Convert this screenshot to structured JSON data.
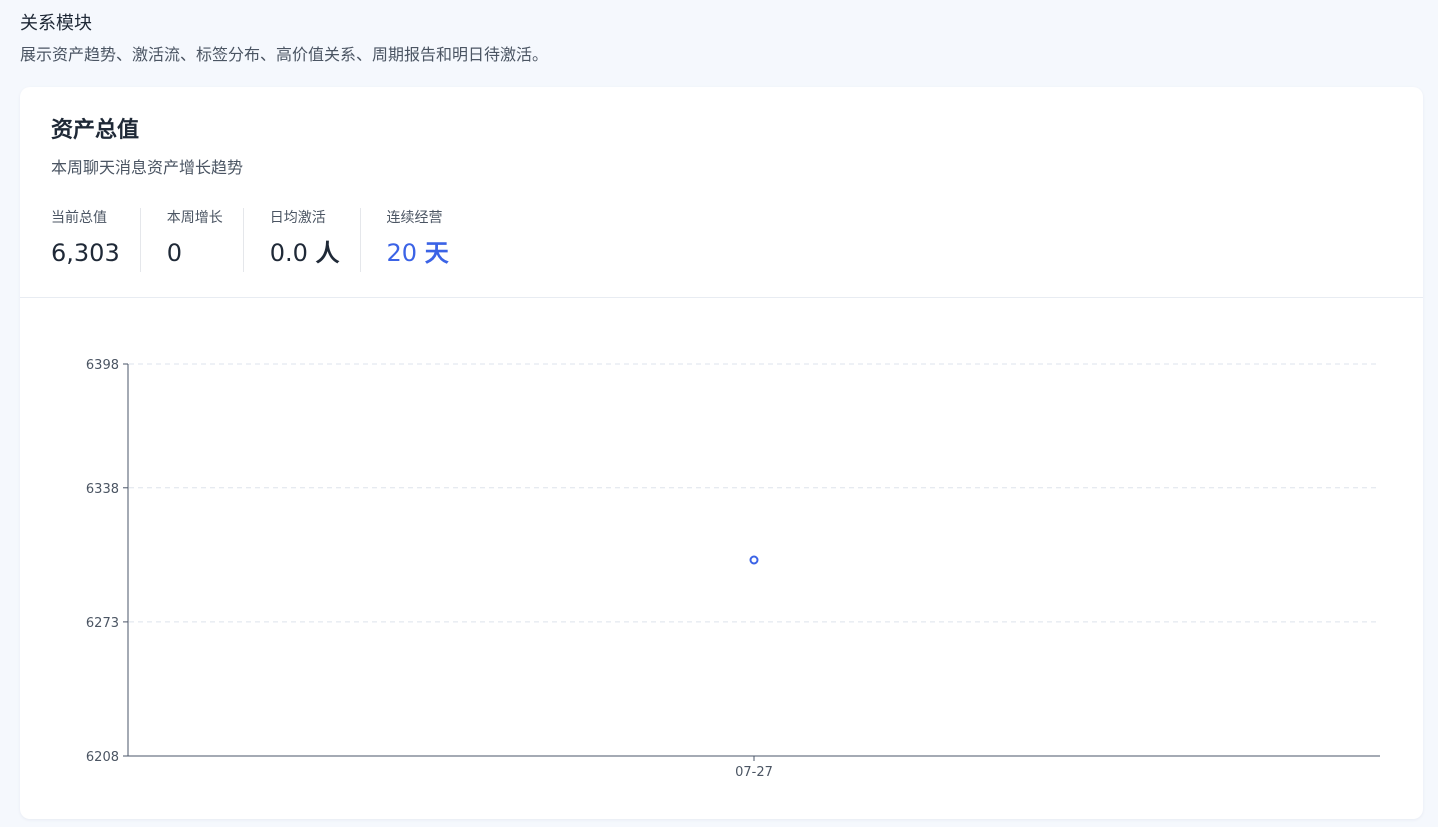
{
  "module": {
    "title": "关系模块",
    "description": "展示资产趋势、激活流、标签分布、高价值关系、周期报告和明日待激活。"
  },
  "card": {
    "title": "资产总值",
    "subtitle": "本周聊天消息资产增长趋势"
  },
  "stats": [
    {
      "label": "当前总值",
      "value": "6,303",
      "unit": ""
    },
    {
      "label": "本周增长",
      "value": "0",
      "unit": ""
    },
    {
      "label": "日均激活",
      "value": "0.0",
      "unit": "人"
    },
    {
      "label": "连续经营",
      "value": "20",
      "unit": "天"
    }
  ],
  "colors": {
    "accent": "#3b63e6",
    "axis": "#4a5568",
    "grid": "#dde3ec"
  },
  "chart_data": {
    "type": "scatter",
    "x": [
      "07-27"
    ],
    "series": [
      {
        "values": [
          6303
        ]
      }
    ],
    "ylim": [
      6208,
      6398
    ],
    "yticks": [
      "6398",
      "6338",
      "6273",
      "6208"
    ],
    "xticks": [
      "07-27"
    ],
    "grid": true
  }
}
